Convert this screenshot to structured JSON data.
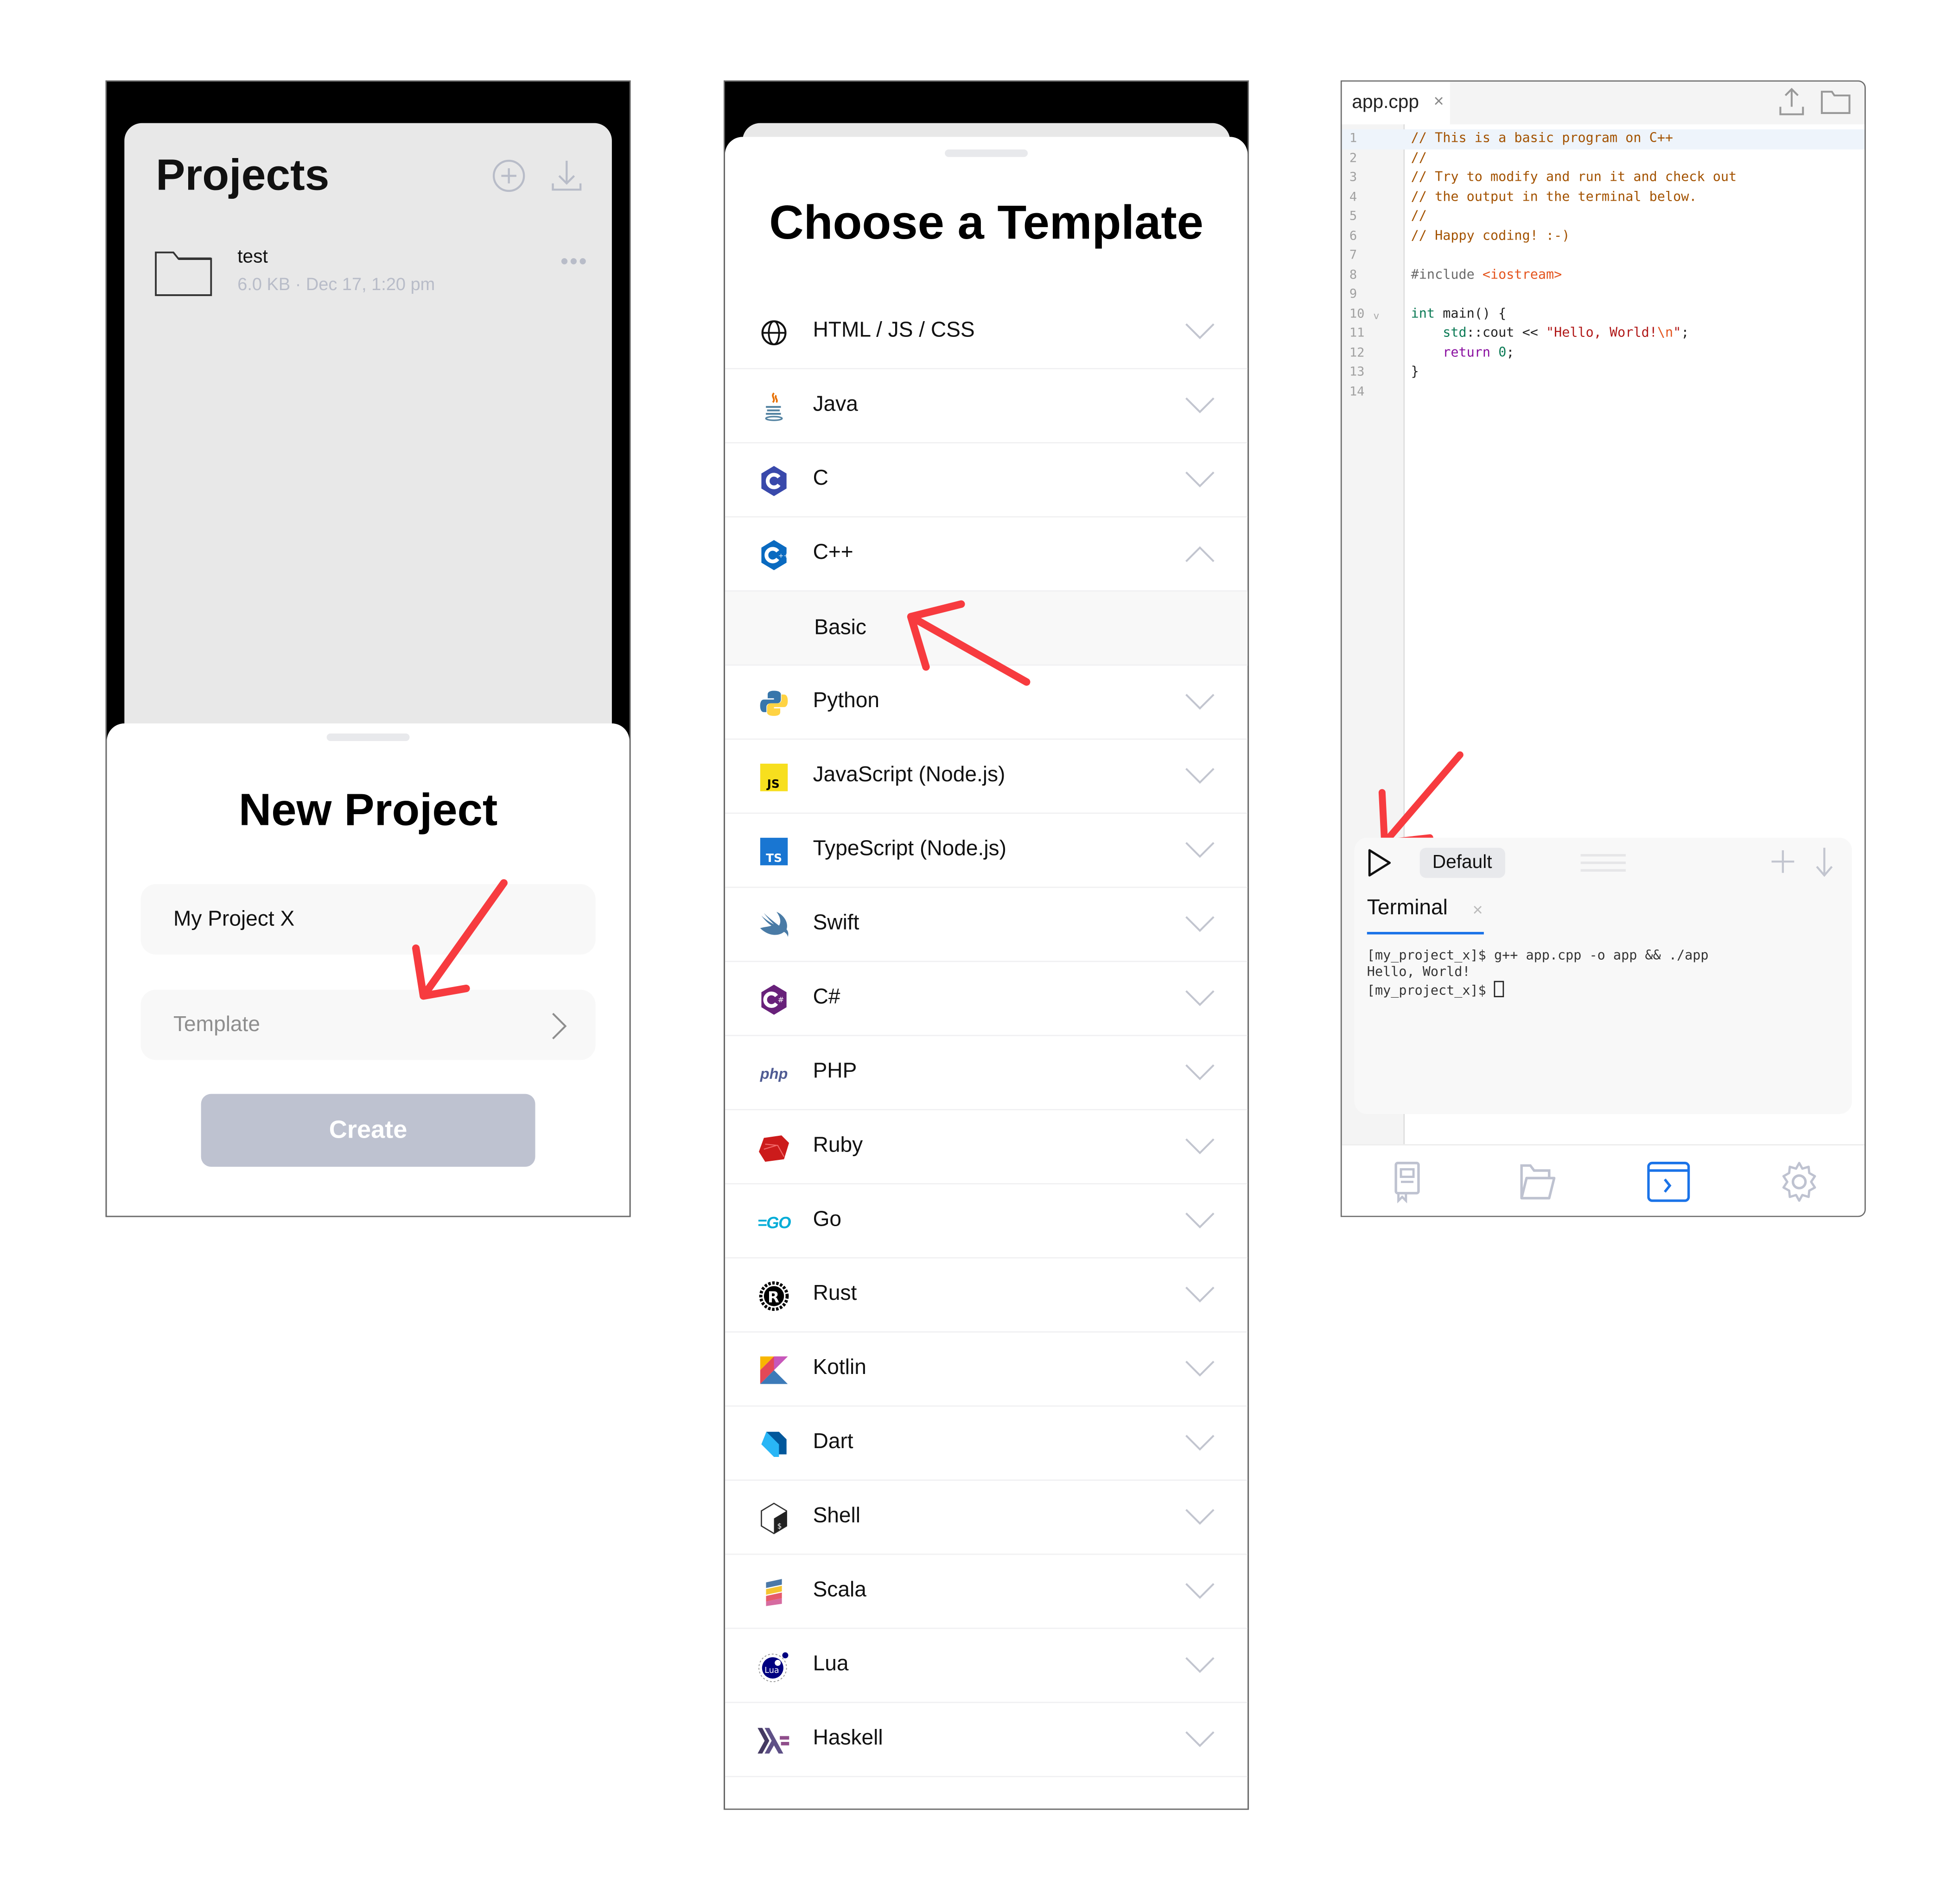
{
  "colors": {
    "accent_blue": "#1a73e8",
    "annotation_red": "#f73b3f",
    "create_button_disabled": "#bec2d0",
    "muted_icon": "#b8bcc8"
  },
  "projects_screen": {
    "title": "Projects",
    "add_icon": "plus-circle-icon",
    "import_icon": "download-icon",
    "projects": [
      {
        "name": "test",
        "meta": "6.0 KB · Dec 17, 1:20 pm",
        "more": "•••"
      }
    ]
  },
  "new_project_sheet": {
    "title": "New Project",
    "name_value": "My Project X",
    "template_placeholder": "Template",
    "create_label": "Create"
  },
  "template_sheet": {
    "title": "Choose a Template",
    "languages": [
      {
        "label": "HTML / JS / CSS",
        "icon": "globe-icon",
        "expanded": false
      },
      {
        "label": "Java",
        "icon": "java-icon",
        "expanded": false
      },
      {
        "label": "C",
        "icon": "c-icon",
        "expanded": false
      },
      {
        "label": "C++",
        "icon": "cpp-icon",
        "expanded": true,
        "options": [
          "Basic"
        ]
      },
      {
        "label": "Python",
        "icon": "python-icon",
        "expanded": false
      },
      {
        "label": "JavaScript (Node.js)",
        "icon": "javascript-icon",
        "expanded": false
      },
      {
        "label": "TypeScript (Node.js)",
        "icon": "typescript-icon",
        "expanded": false
      },
      {
        "label": "Swift",
        "icon": "swift-icon",
        "expanded": false
      },
      {
        "label": "C#",
        "icon": "csharp-icon",
        "expanded": false
      },
      {
        "label": "PHP",
        "icon": "php-icon",
        "expanded": false
      },
      {
        "label": "Ruby",
        "icon": "ruby-icon",
        "expanded": false
      },
      {
        "label": "Go",
        "icon": "go-icon",
        "expanded": false
      },
      {
        "label": "Rust",
        "icon": "rust-icon",
        "expanded": false
      },
      {
        "label": "Kotlin",
        "icon": "kotlin-icon",
        "expanded": false
      },
      {
        "label": "Dart",
        "icon": "dart-icon",
        "expanded": false
      },
      {
        "label": "Shell",
        "icon": "shell-icon",
        "expanded": false
      },
      {
        "label": "Scala",
        "icon": "scala-icon",
        "expanded": false
      },
      {
        "label": "Lua",
        "icon": "lua-icon",
        "expanded": false
      },
      {
        "label": "Haskell",
        "icon": "haskell-icon",
        "expanded": false
      }
    ],
    "icon_text": {
      "js": "JS",
      "ts": "TS",
      "php": "php",
      "go": "GO",
      "lua": "Lua"
    }
  },
  "editor": {
    "tab_name": "app.cpp",
    "tab_close": "×",
    "code_lines": [
      {
        "n": "1",
        "tokens": [
          [
            "cm",
            "// This is a basic program on C++"
          ]
        ]
      },
      {
        "n": "2",
        "tokens": [
          [
            "cm",
            "//"
          ]
        ]
      },
      {
        "n": "3",
        "tokens": [
          [
            "cm",
            "// Try to modify and run it and check out"
          ]
        ]
      },
      {
        "n": "4",
        "tokens": [
          [
            "cm",
            "// the output in the terminal below."
          ]
        ]
      },
      {
        "n": "5",
        "tokens": [
          [
            "cm",
            "//"
          ]
        ]
      },
      {
        "n": "6",
        "tokens": [
          [
            "cm",
            "// Happy coding! :-)"
          ]
        ]
      },
      {
        "n": "7",
        "tokens": []
      },
      {
        "n": "8",
        "tokens": [
          [
            "pp",
            "#include "
          ],
          [
            "inc",
            "<iostream>"
          ]
        ]
      },
      {
        "n": "9",
        "tokens": []
      },
      {
        "n": "10",
        "fold": "v",
        "tokens": [
          [
            "kw",
            "int"
          ],
          [
            "pl",
            " main() {"
          ]
        ]
      },
      {
        "n": "11",
        "tokens": [
          [
            "pl",
            "    "
          ],
          [
            "kw",
            "std"
          ],
          [
            "pl",
            "::cout << "
          ],
          [
            "str",
            "\"Hello, World!"
          ],
          [
            "esc",
            "\\n"
          ],
          [
            "str",
            "\""
          ],
          [
            "pl",
            ";"
          ]
        ]
      },
      {
        "n": "12",
        "tokens": [
          [
            "pl",
            "    "
          ],
          [
            "ret",
            "return"
          ],
          [
            "pl",
            " "
          ],
          [
            "num",
            "0"
          ],
          [
            "pl",
            ";"
          ]
        ]
      },
      {
        "n": "13",
        "tokens": [
          [
            "pl",
            "}"
          ]
        ]
      },
      {
        "n": "14",
        "tokens": []
      }
    ],
    "terminal": {
      "scheme_label": "Default",
      "tab_label": "Terminal",
      "tab_close": "×",
      "output_lines": [
        "[my_project_x]$ g++ app.cpp -o app && ./app",
        "Hello, World!",
        "[my_project_x]$ "
      ]
    },
    "bottom_nav": [
      "book-icon",
      "folder-open-icon",
      "terminal-icon",
      "gear-icon"
    ],
    "active_nav": "terminal-icon"
  }
}
